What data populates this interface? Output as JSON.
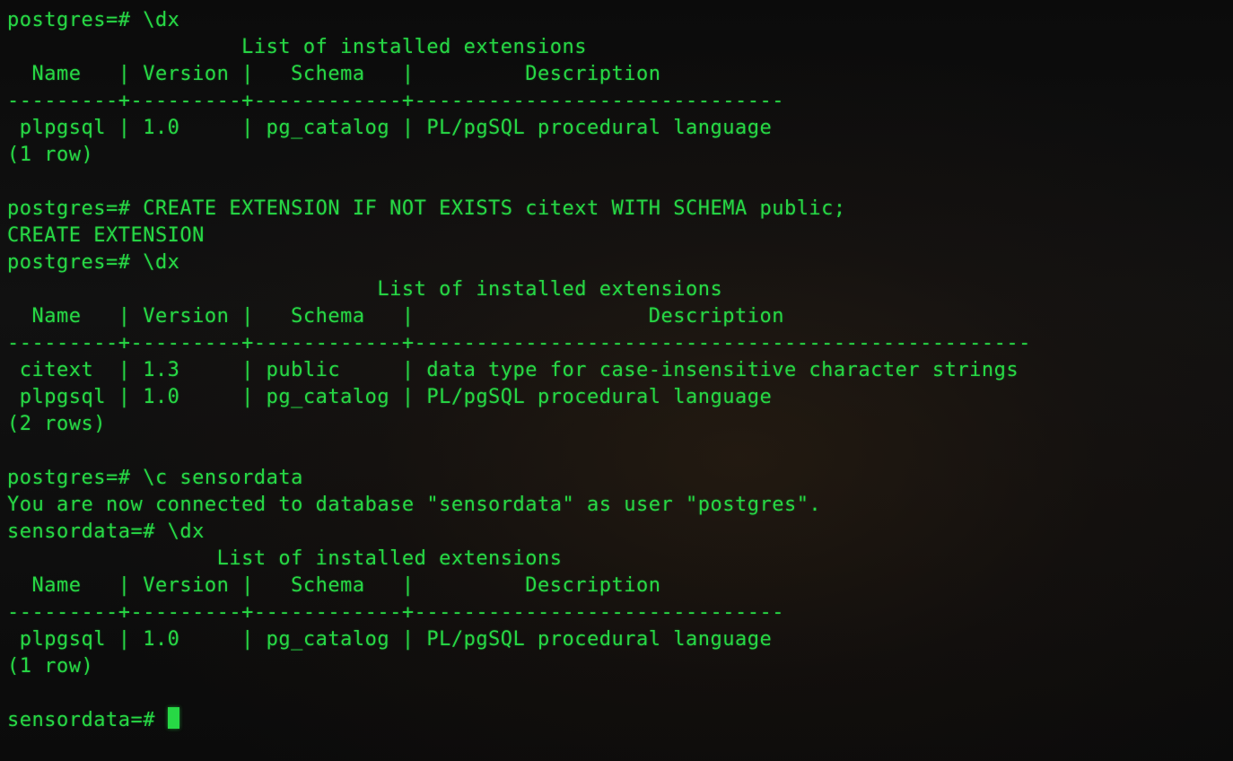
{
  "lines": {
    "l0": "postgres=# \\dx",
    "l1": "                   List of installed extensions",
    "l2": "  Name   | Version |   Schema   |         Description          ",
    "l3": "---------+---------+------------+------------------------------",
    "l4": " plpgsql | 1.0     | pg_catalog | PL/pgSQL procedural language",
    "l5": "(1 row)",
    "l6": "",
    "l7": "postgres=# CREATE EXTENSION IF NOT EXISTS citext WITH SCHEMA public;",
    "l8": "CREATE EXTENSION",
    "l9": "postgres=# \\dx",
    "l10": "                              List of installed extensions",
    "l11": "  Name   | Version |   Schema   |                   Description                    ",
    "l12": "---------+---------+------------+--------------------------------------------------",
    "l13": " citext  | 1.3     | public     | data type for case-insensitive character strings",
    "l14": " plpgsql | 1.0     | pg_catalog | PL/pgSQL procedural language",
    "l15": "(2 rows)",
    "l16": "",
    "l17": "postgres=# \\c sensordata",
    "l18": "You are now connected to database \"sensordata\" as user \"postgres\".",
    "l19": "sensordata=# \\dx",
    "l20": "                 List of installed extensions",
    "l21": "  Name   | Version |   Schema   |         Description          ",
    "l22": "---------+---------+------------+------------------------------",
    "l23": " plpgsql | 1.0     | pg_catalog | PL/pgSQL procedural language",
    "l24": "(1 row)",
    "l25": "",
    "l26": "sensordata=# "
  }
}
